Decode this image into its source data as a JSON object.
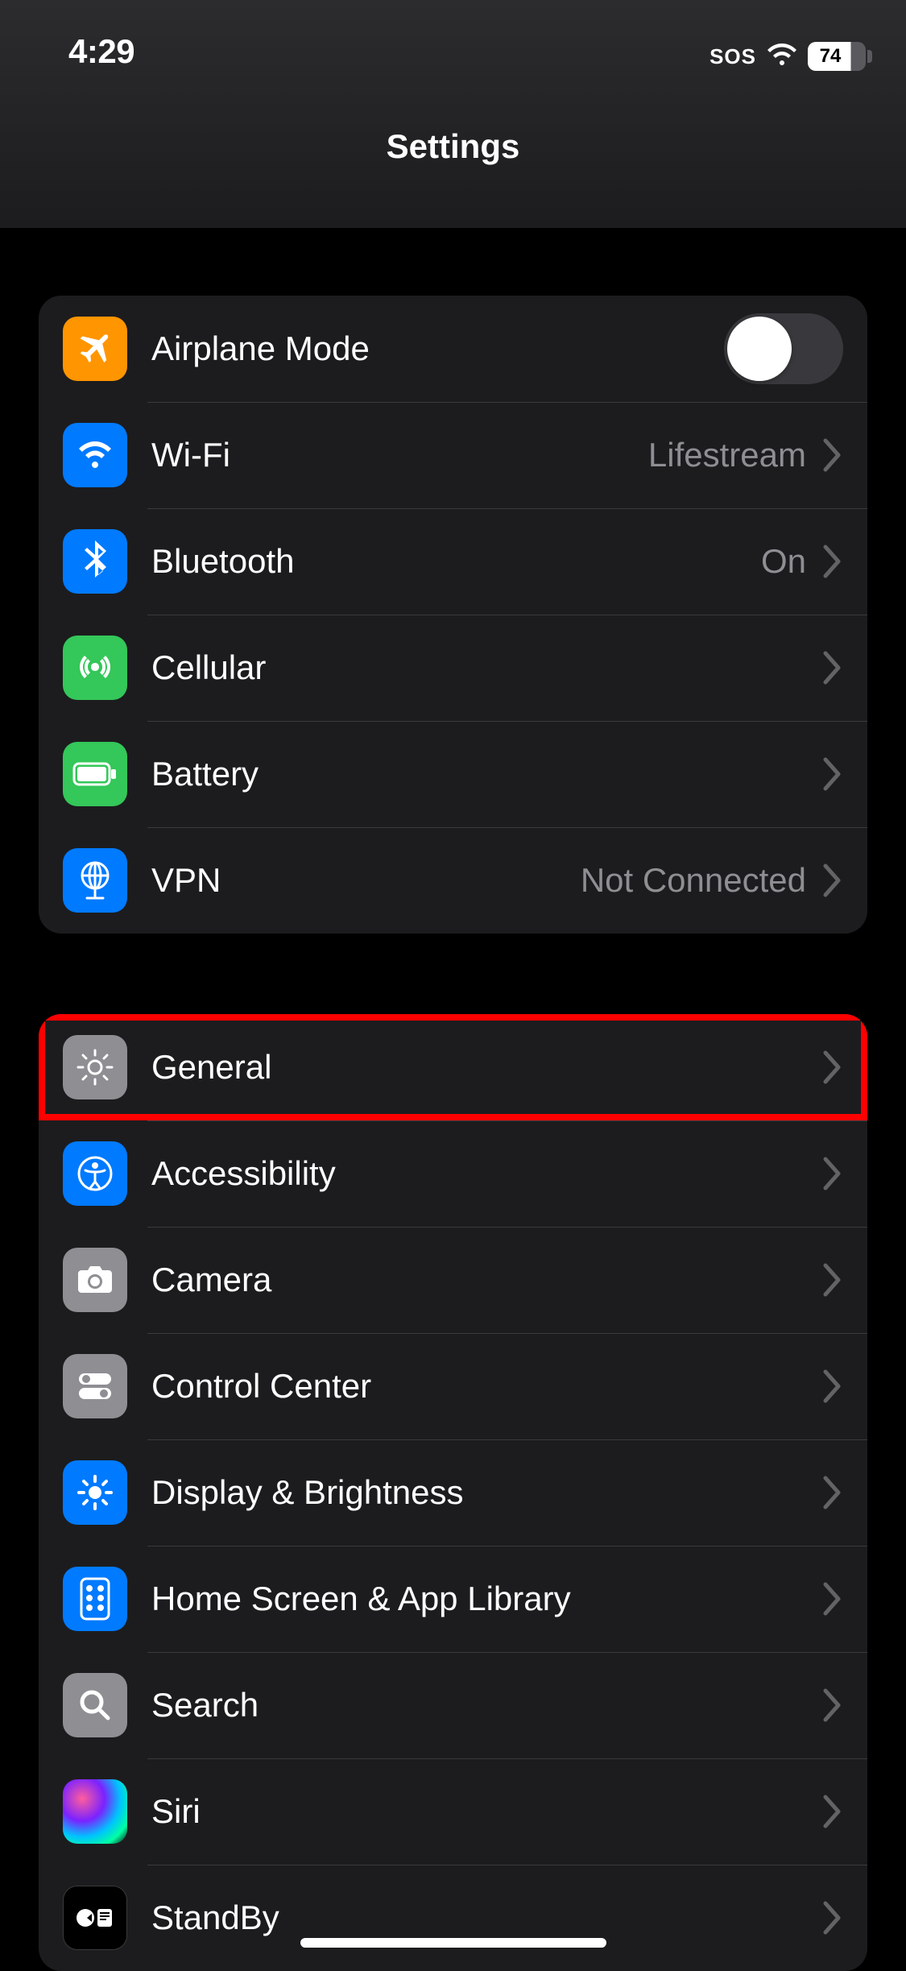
{
  "status": {
    "time": "4:29",
    "sos": "SOS",
    "battery": "74"
  },
  "header": {
    "title": "Settings"
  },
  "group1": {
    "airplane": {
      "label": "Airplane Mode",
      "color": "#ff9500"
    },
    "wifi": {
      "label": "Wi-Fi",
      "value": "Lifestream",
      "color": "#007aff"
    },
    "bluetooth": {
      "label": "Bluetooth",
      "value": "On",
      "color": "#007aff"
    },
    "cellular": {
      "label": "Cellular",
      "color": "#34c759"
    },
    "battery": {
      "label": "Battery",
      "color": "#34c759"
    },
    "vpn": {
      "label": "VPN",
      "value": "Not Connected",
      "color": "#007aff"
    }
  },
  "group2": {
    "general": {
      "label": "General",
      "color": "#8e8e93"
    },
    "accessibility": {
      "label": "Accessibility",
      "color": "#007aff"
    },
    "camera": {
      "label": "Camera",
      "color": "#8e8e93"
    },
    "controlcenter": {
      "label": "Control Center",
      "color": "#8e8e93"
    },
    "display": {
      "label": "Display & Brightness",
      "color": "#007aff"
    },
    "homescreen": {
      "label": "Home Screen & App Library",
      "color": "#007aff"
    },
    "search": {
      "label": "Search",
      "color": "#8e8e93"
    },
    "siri": {
      "label": "Siri"
    },
    "standby": {
      "label": "StandBy",
      "color": "#000000"
    }
  },
  "highlight": {
    "target": "group2.general"
  }
}
